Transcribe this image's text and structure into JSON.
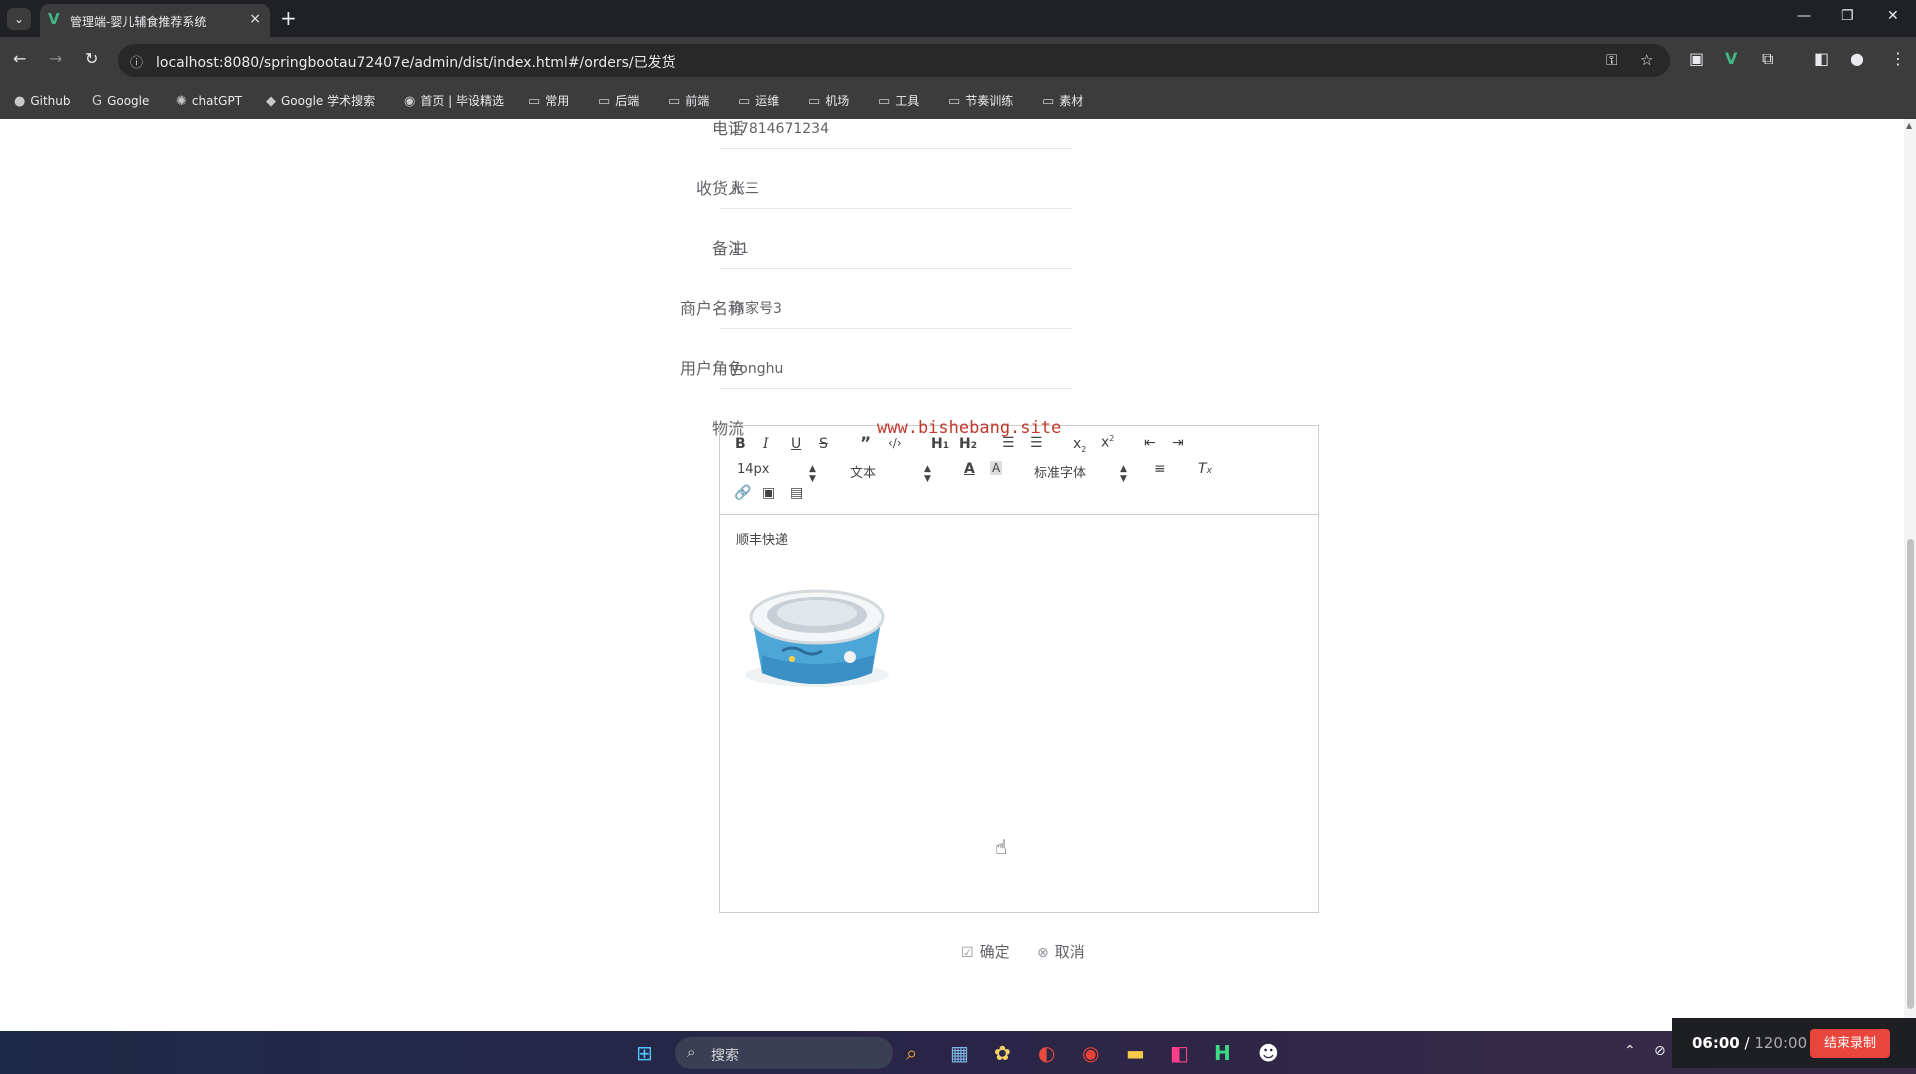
{
  "browser": {
    "tab_title": "管理端-婴儿辅食推荐系统",
    "tab_close": "×",
    "new_tab": "+",
    "url": "localhost:8080/springbootau72407e/admin/dist/index.html#/orders/已发货",
    "bookmarks": [
      {
        "label": "Github",
        "icon": "github-icon"
      },
      {
        "label": "Google",
        "icon": "google-icon"
      },
      {
        "label": "chatGPT",
        "icon": "chatgpt-icon"
      },
      {
        "label": "Google 学术搜索",
        "icon": "scholar-icon"
      },
      {
        "label": "首页 | 毕设精选",
        "icon": "site-icon"
      },
      {
        "label": "常用",
        "icon": "folder-icon"
      },
      {
        "label": "后端",
        "icon": "folder-icon"
      },
      {
        "label": "前端",
        "icon": "folder-icon"
      },
      {
        "label": "运维",
        "icon": "folder-icon"
      },
      {
        "label": "机场",
        "icon": "folder-icon"
      },
      {
        "label": "工具",
        "icon": "folder-icon"
      },
      {
        "label": "节奏训练",
        "icon": "folder-icon"
      },
      {
        "label": "素材",
        "icon": "folder-icon"
      }
    ]
  },
  "form": {
    "phone_label": "电话",
    "phone_value": "17814671234",
    "receiver_label": "收货人",
    "receiver_value": "张三",
    "remark_label": "备注",
    "remark_value": "11",
    "merchant_label": "商户名称",
    "merchant_value": "商家号3",
    "role_label": "用户角色",
    "role_value": "yonghu",
    "logistics_label": "物流"
  },
  "editor": {
    "font_size": "14px",
    "block_format": "文本",
    "font_family": "标准字体",
    "content_text": "顺丰快递"
  },
  "watermark": "www.bishebang.site",
  "actions": {
    "confirm": "确定",
    "cancel": "取消"
  },
  "taskbar": {
    "search_placeholder": "搜索"
  },
  "recording": {
    "elapsed": "06:00",
    "separator": " / ",
    "total": "120:00",
    "stop": "结束录制"
  },
  "colors": {
    "accent_vue": "#41b883",
    "watermark": "#c0392b",
    "record_stop": "#e8453c"
  }
}
